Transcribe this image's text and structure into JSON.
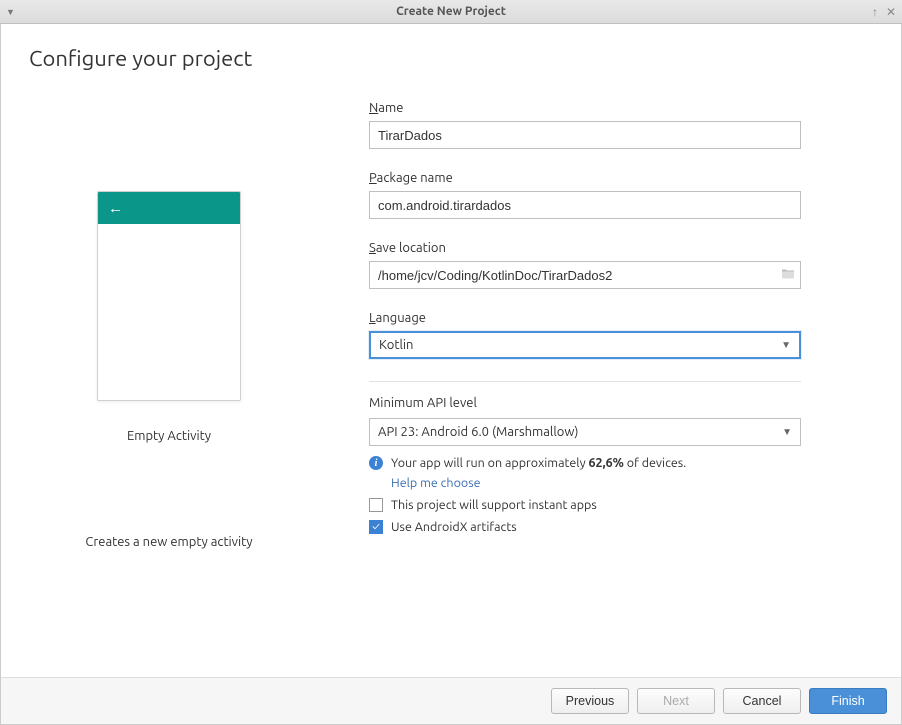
{
  "window": {
    "title": "Create New Project"
  },
  "heading": "Configure your project",
  "preview": {
    "template_name": "Empty Activity",
    "description": "Creates a new empty activity"
  },
  "form": {
    "name_label": "Name",
    "name_value": "TirarDados",
    "package_label": "Package name",
    "package_value": "com.android.tirardados",
    "save_label": "Save location",
    "save_value": "/home/jcv/Coding/KotlinDoc/TirarDados2",
    "language_label": "Language",
    "language_value": "Kotlin",
    "min_api_label": "Minimum API level",
    "min_api_value": "API 23: Android 6.0 (Marshmallow)",
    "info_prefix": "Your app will run on approximately ",
    "info_percent": "62,6%",
    "info_suffix": " of devices.",
    "help_link": "Help me choose",
    "instant_apps_label": "This project will support instant apps",
    "instant_apps_checked": false,
    "androidx_label": "Use AndroidX artifacts",
    "androidx_checked": true
  },
  "buttons": {
    "previous": "Previous",
    "next": "Next",
    "cancel": "Cancel",
    "finish": "Finish"
  }
}
